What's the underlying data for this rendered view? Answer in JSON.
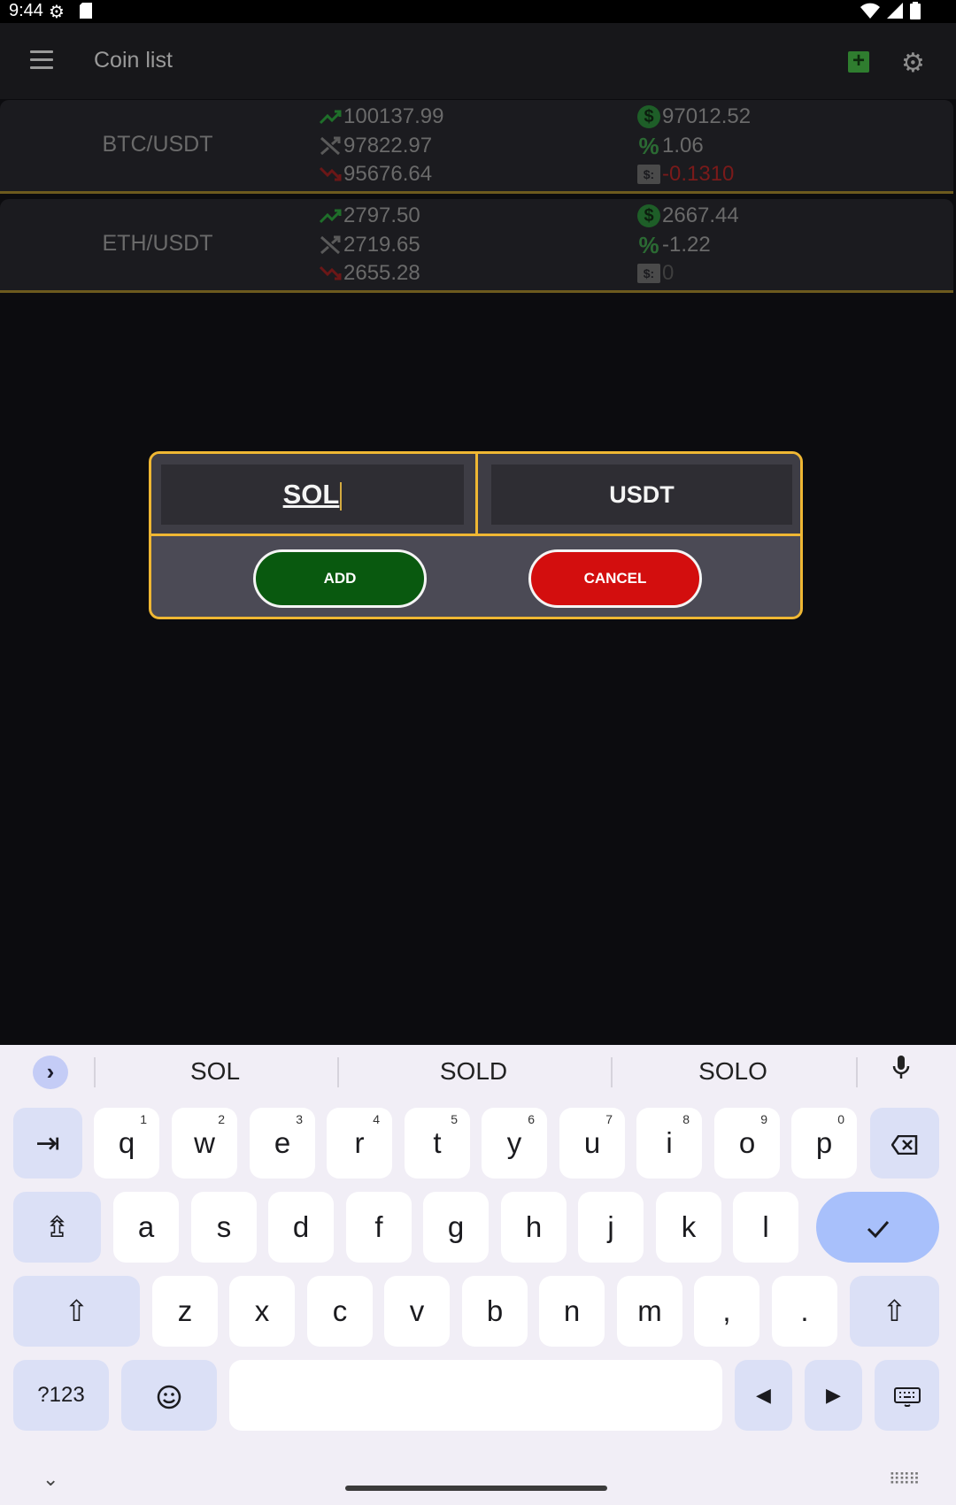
{
  "status_bar": {
    "time": "9:44"
  },
  "app_bar": {
    "title": "Coin list"
  },
  "coins": [
    {
      "pair": "BTC/USDT",
      "high": "100137.99",
      "mid": "97822.97",
      "low": "95676.64",
      "price": "97012.52",
      "change_pct": "1.06",
      "change_abs": "-0.1310"
    },
    {
      "pair": "ETH/USDT",
      "high": "2797.50",
      "mid": "2719.65",
      "low": "2655.28",
      "price": "2667.44",
      "change_pct": "-1.22",
      "change_abs": "0"
    }
  ],
  "dialog": {
    "base_value": "SOL",
    "quote_value": "USDT",
    "add_label": "ADD",
    "cancel_label": "CANCEL"
  },
  "keyboard": {
    "suggestions": [
      "SOL",
      "SOLD",
      "SOLO"
    ],
    "row1": [
      {
        "label": "q",
        "hint": "1"
      },
      {
        "label": "w",
        "hint": "2"
      },
      {
        "label": "e",
        "hint": "3"
      },
      {
        "label": "r",
        "hint": "4"
      },
      {
        "label": "t",
        "hint": "5"
      },
      {
        "label": "y",
        "hint": "6"
      },
      {
        "label": "u",
        "hint": "7"
      },
      {
        "label": "i",
        "hint": "8"
      },
      {
        "label": "o",
        "hint": "9"
      },
      {
        "label": "p",
        "hint": "0"
      }
    ],
    "row2": [
      "a",
      "s",
      "d",
      "f",
      "g",
      "h",
      "j",
      "k",
      "l"
    ],
    "row3": [
      "z",
      "x",
      "c",
      "v",
      "b",
      "n",
      "m",
      ",",
      "."
    ],
    "symbols_label": "?123"
  },
  "colors": {
    "accent_gold": "#efb733",
    "add_green": "#09590f",
    "cancel_red": "#d30e0e",
    "negative_red": "#7a1a1a"
  }
}
